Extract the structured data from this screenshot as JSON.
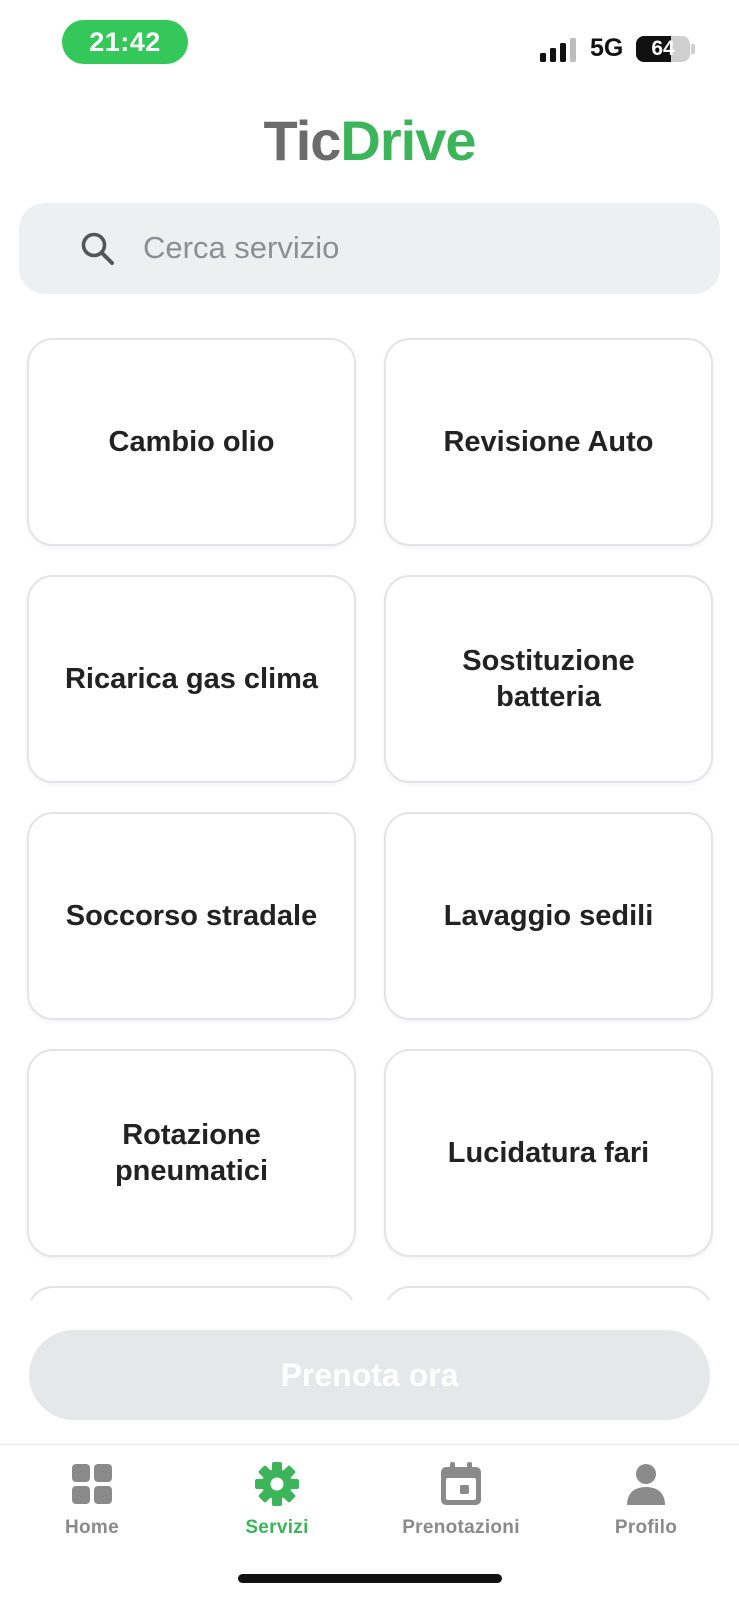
{
  "status_bar": {
    "time": "21:42",
    "network": "5G",
    "battery_level": "64",
    "battery_fraction": 0.64,
    "time_pill_color": "#34c759"
  },
  "logo": {
    "part1": "Tic",
    "part2": "Drive",
    "color1": "#6b6b6b",
    "color2": "#3cb55a"
  },
  "search": {
    "placeholder": "Cerca servizio",
    "value": "",
    "icon": "search-icon"
  },
  "services": [
    {
      "label": "Cambio olio"
    },
    {
      "label": "Revisione Auto"
    },
    {
      "label": "Ricarica gas clima"
    },
    {
      "label": "Sostituzione batteria"
    },
    {
      "label": "Soccorso stradale"
    },
    {
      "label": "Lavaggio sedili"
    },
    {
      "label": "Rotazione pneumatici"
    },
    {
      "label": "Lucidatura fari"
    },
    {
      "label": ""
    },
    {
      "label": ""
    }
  ],
  "cta": {
    "label": "Prenota ora",
    "disabled": true
  },
  "tab_bar": {
    "accent": "#3cb55a",
    "items": [
      {
        "label": "Home",
        "icon": "grid-icon",
        "active": false
      },
      {
        "label": "Servizi",
        "icon": "gear-icon",
        "active": true
      },
      {
        "label": "Prenotazioni",
        "icon": "calendar-icon",
        "active": false
      },
      {
        "label": "Profilo",
        "icon": "person-icon",
        "active": false
      }
    ]
  }
}
